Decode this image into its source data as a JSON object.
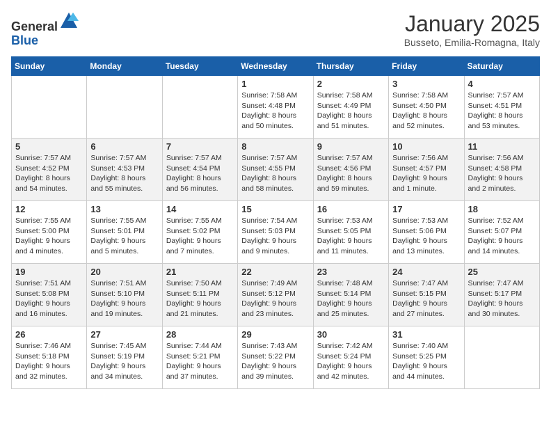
{
  "logo": {
    "general": "General",
    "blue": "Blue"
  },
  "header": {
    "month": "January 2025",
    "location": "Busseto, Emilia-Romagna, Italy"
  },
  "days_of_week": [
    "Sunday",
    "Monday",
    "Tuesday",
    "Wednesday",
    "Thursday",
    "Friday",
    "Saturday"
  ],
  "weeks": [
    {
      "row": 1,
      "cells": [
        {
          "day": null,
          "content": null
        },
        {
          "day": null,
          "content": null
        },
        {
          "day": null,
          "content": null
        },
        {
          "day": "1",
          "content": "Sunrise: 7:58 AM\nSunset: 4:48 PM\nDaylight: 8 hours\nand 50 minutes."
        },
        {
          "day": "2",
          "content": "Sunrise: 7:58 AM\nSunset: 4:49 PM\nDaylight: 8 hours\nand 51 minutes."
        },
        {
          "day": "3",
          "content": "Sunrise: 7:58 AM\nSunset: 4:50 PM\nDaylight: 8 hours\nand 52 minutes."
        },
        {
          "day": "4",
          "content": "Sunrise: 7:57 AM\nSunset: 4:51 PM\nDaylight: 8 hours\nand 53 minutes."
        }
      ]
    },
    {
      "row": 2,
      "cells": [
        {
          "day": "5",
          "content": "Sunrise: 7:57 AM\nSunset: 4:52 PM\nDaylight: 8 hours\nand 54 minutes."
        },
        {
          "day": "6",
          "content": "Sunrise: 7:57 AM\nSunset: 4:53 PM\nDaylight: 8 hours\nand 55 minutes."
        },
        {
          "day": "7",
          "content": "Sunrise: 7:57 AM\nSunset: 4:54 PM\nDaylight: 8 hours\nand 56 minutes."
        },
        {
          "day": "8",
          "content": "Sunrise: 7:57 AM\nSunset: 4:55 PM\nDaylight: 8 hours\nand 58 minutes."
        },
        {
          "day": "9",
          "content": "Sunrise: 7:57 AM\nSunset: 4:56 PM\nDaylight: 8 hours\nand 59 minutes."
        },
        {
          "day": "10",
          "content": "Sunrise: 7:56 AM\nSunset: 4:57 PM\nDaylight: 9 hours\nand 1 minute."
        },
        {
          "day": "11",
          "content": "Sunrise: 7:56 AM\nSunset: 4:58 PM\nDaylight: 9 hours\nand 2 minutes."
        }
      ]
    },
    {
      "row": 3,
      "cells": [
        {
          "day": "12",
          "content": "Sunrise: 7:55 AM\nSunset: 5:00 PM\nDaylight: 9 hours\nand 4 minutes."
        },
        {
          "day": "13",
          "content": "Sunrise: 7:55 AM\nSunset: 5:01 PM\nDaylight: 9 hours\nand 5 minutes."
        },
        {
          "day": "14",
          "content": "Sunrise: 7:55 AM\nSunset: 5:02 PM\nDaylight: 9 hours\nand 7 minutes."
        },
        {
          "day": "15",
          "content": "Sunrise: 7:54 AM\nSunset: 5:03 PM\nDaylight: 9 hours\nand 9 minutes."
        },
        {
          "day": "16",
          "content": "Sunrise: 7:53 AM\nSunset: 5:05 PM\nDaylight: 9 hours\nand 11 minutes."
        },
        {
          "day": "17",
          "content": "Sunrise: 7:53 AM\nSunset: 5:06 PM\nDaylight: 9 hours\nand 13 minutes."
        },
        {
          "day": "18",
          "content": "Sunrise: 7:52 AM\nSunset: 5:07 PM\nDaylight: 9 hours\nand 14 minutes."
        }
      ]
    },
    {
      "row": 4,
      "cells": [
        {
          "day": "19",
          "content": "Sunrise: 7:51 AM\nSunset: 5:08 PM\nDaylight: 9 hours\nand 16 minutes."
        },
        {
          "day": "20",
          "content": "Sunrise: 7:51 AM\nSunset: 5:10 PM\nDaylight: 9 hours\nand 19 minutes."
        },
        {
          "day": "21",
          "content": "Sunrise: 7:50 AM\nSunset: 5:11 PM\nDaylight: 9 hours\nand 21 minutes."
        },
        {
          "day": "22",
          "content": "Sunrise: 7:49 AM\nSunset: 5:12 PM\nDaylight: 9 hours\nand 23 minutes."
        },
        {
          "day": "23",
          "content": "Sunrise: 7:48 AM\nSunset: 5:14 PM\nDaylight: 9 hours\nand 25 minutes."
        },
        {
          "day": "24",
          "content": "Sunrise: 7:47 AM\nSunset: 5:15 PM\nDaylight: 9 hours\nand 27 minutes."
        },
        {
          "day": "25",
          "content": "Sunrise: 7:47 AM\nSunset: 5:17 PM\nDaylight: 9 hours\nand 30 minutes."
        }
      ]
    },
    {
      "row": 5,
      "cells": [
        {
          "day": "26",
          "content": "Sunrise: 7:46 AM\nSunset: 5:18 PM\nDaylight: 9 hours\nand 32 minutes."
        },
        {
          "day": "27",
          "content": "Sunrise: 7:45 AM\nSunset: 5:19 PM\nDaylight: 9 hours\nand 34 minutes."
        },
        {
          "day": "28",
          "content": "Sunrise: 7:44 AM\nSunset: 5:21 PM\nDaylight: 9 hours\nand 37 minutes."
        },
        {
          "day": "29",
          "content": "Sunrise: 7:43 AM\nSunset: 5:22 PM\nDaylight: 9 hours\nand 39 minutes."
        },
        {
          "day": "30",
          "content": "Sunrise: 7:42 AM\nSunset: 5:24 PM\nDaylight: 9 hours\nand 42 minutes."
        },
        {
          "day": "31",
          "content": "Sunrise: 7:40 AM\nSunset: 5:25 PM\nDaylight: 9 hours\nand 44 minutes."
        },
        {
          "day": null,
          "content": null
        }
      ]
    }
  ]
}
